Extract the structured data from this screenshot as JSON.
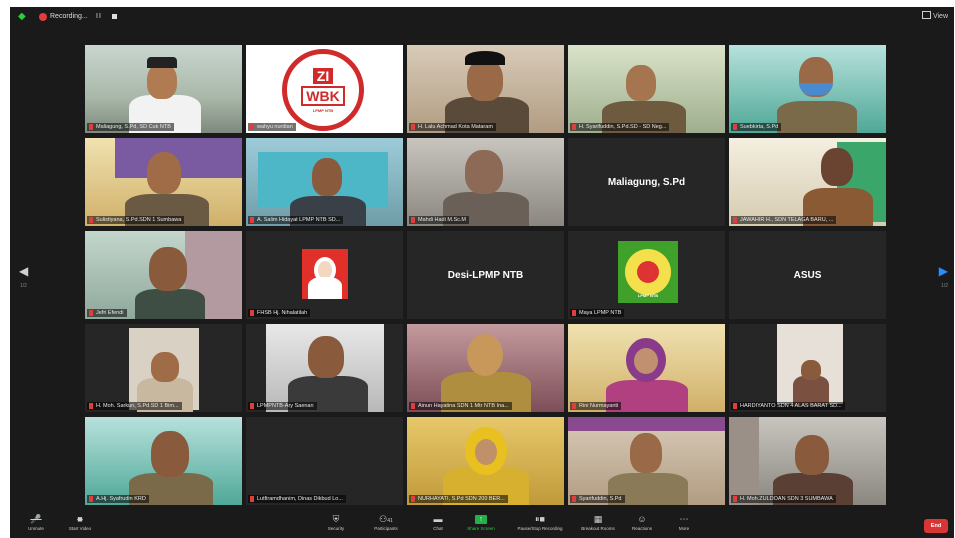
{
  "topbar": {
    "recording_label": "Recording...",
    "pause_glyph": "II",
    "view_label": "View"
  },
  "nav": {
    "left_arrow": "◀",
    "right_arrow": "▶",
    "left_page": "1/2",
    "right_page": "1/2"
  },
  "tiles": [
    {
      "name": "Maliagung, S.Pd, SD Cuk NTB",
      "kind": "photo"
    },
    {
      "name": "wahyu nurdian",
      "kind": "logo-zi"
    },
    {
      "name": "H. Lalu Achmad Kota Mataram",
      "kind": "photo"
    },
    {
      "name": "H. Syarifuddin, S.Pd.SD - SD Neg...",
      "kind": "photo"
    },
    {
      "name": "Suebkirta, S.Pd",
      "kind": "photo"
    },
    {
      "name": "Sulistiyana, S.Pd.SDN 1 Sumbawa",
      "kind": "photo"
    },
    {
      "name": "A. Salim Hidayat LPMP NTB SD...",
      "kind": "photo"
    },
    {
      "name": "Mahdi Hadi M.Sc.M",
      "kind": "photo"
    },
    {
      "name": "Maliagung, S.Pd",
      "kind": "name-only"
    },
    {
      "name": "JAWAHIR H., SDN TELAGA BARU, ...",
      "kind": "photo"
    },
    {
      "name": "Jefri Efendi",
      "kind": "photo"
    },
    {
      "name": "FHSB Hj. Nihalatilah",
      "kind": "avatar"
    },
    {
      "name": "Desi-LPMP NTB",
      "kind": "name-only"
    },
    {
      "name": "Maya LPMP NTB",
      "kind": "logo-lpmp"
    },
    {
      "name": "ASUS",
      "kind": "name-only"
    },
    {
      "name": "H. Moh. Sarkun, S.Pd.SD 1 Bim...",
      "kind": "photo"
    },
    {
      "name": "LPMPNTB-Ary Saenan",
      "kind": "photo"
    },
    {
      "name": "Ainun Hayatina SDN 1 Mtr NTB Ina...",
      "kind": "photo"
    },
    {
      "name": "Rini Nurmayanti",
      "kind": "photo"
    },
    {
      "name": "HARDIYANTO SDN 4 ALAS BARAT SD...",
      "kind": "photo"
    },
    {
      "name": "A.Hj. Syafrudin KRD",
      "kind": "photo"
    },
    {
      "name": "Lutfiramdhanim, Dinas Dikbud Lo...",
      "kind": "empty"
    },
    {
      "name": "NURHAYATI, S.Pd SDN 200 BER...",
      "kind": "photo"
    },
    {
      "name": "Syarifuddin, S.Pd",
      "kind": "photo"
    },
    {
      "name": "H. Moh.ZULDOAN SDN 3 SUMBAWA",
      "kind": "photo"
    }
  ],
  "name_only_labels": {
    "t8": "Maliagung, S.Pd",
    "t12": "Desi-LPMP NTB",
    "t14": "ASUS"
  },
  "logos": {
    "zi": "ZI",
    "wbk": "WBK",
    "ring": "LPMP NTB",
    "lpmp_caption": "LPMP NTB"
  },
  "toolbar": {
    "unmute": "Unmute",
    "start_video": "Start Video",
    "security": "Security",
    "participants": "Participants",
    "participants_count": "41",
    "chat": "Chat",
    "share_screen": "Share Screen",
    "pause_recording": "Pause/Stop Recording",
    "breakout": "Breakout Rooms",
    "reactions": "Reactions",
    "more": "More",
    "end": "End"
  },
  "colors": {
    "background": "#1a1a1a",
    "tile": "#262626",
    "active_speaker": "#e6d33b",
    "share_green": "#23b04a",
    "end_red": "#d93535",
    "accent_blue": "#2d8cff"
  }
}
